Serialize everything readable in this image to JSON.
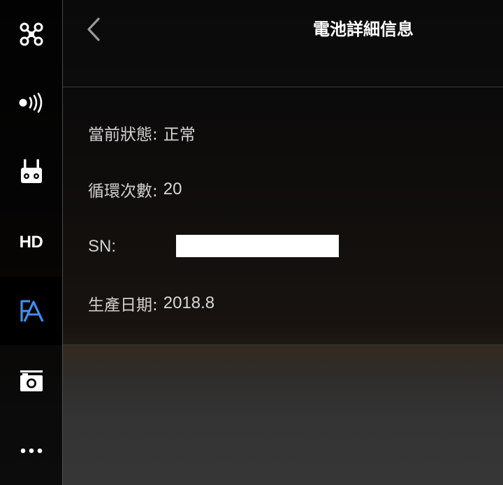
{
  "sidebar": {
    "items": [
      {
        "name": "aircraft",
        "icon": "drone-icon"
      },
      {
        "name": "signal",
        "icon": "signal-icon"
      },
      {
        "name": "remote",
        "icon": "remote-controller-icon"
      },
      {
        "name": "hd",
        "label": "HD"
      },
      {
        "name": "battery",
        "icon": "battery-a-icon",
        "active": true
      },
      {
        "name": "camera",
        "icon": "camera-icon"
      },
      {
        "name": "more",
        "icon": "more-icon"
      }
    ],
    "accent": "#3f8ff0"
  },
  "header": {
    "title": "電池詳細信息"
  },
  "details": {
    "status_label": "當前狀態:",
    "status_value": "正常",
    "cycles_label": "循環次數:",
    "cycles_value": "20",
    "sn_label": "SN:",
    "date_label": "生產日期:",
    "date_value": "2018.8"
  }
}
